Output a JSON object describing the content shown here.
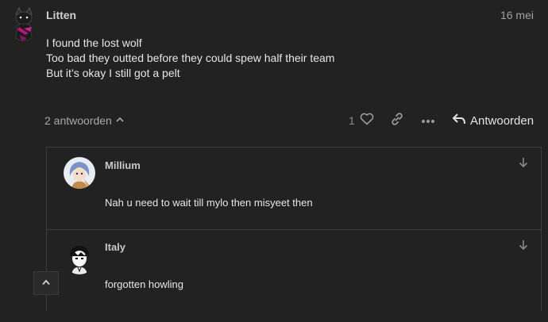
{
  "post": {
    "username": "Litten",
    "date": "16 mei",
    "lines": [
      "I found the lost wolf",
      "Too bad they outted before they could spew half their team",
      "But it’s okay I still got a pelt"
    ],
    "avatar_icon": "litten-avatar"
  },
  "actions": {
    "replies_label": "2 antwoorden",
    "like_count": "1",
    "reply_label": "Antwoorden",
    "icons": [
      "chevron-up-icon",
      "heart-icon",
      "link-icon",
      "more-icon",
      "reply-arrow-icon"
    ]
  },
  "replies": [
    {
      "username": "Millium",
      "text": "Nah u need to wait till mylo then misyeet then",
      "avatar_icon": "millium-avatar"
    },
    {
      "username": "Italy",
      "text": "forgotten howling",
      "avatar_icon": "italy-avatar"
    }
  ],
  "colors": {
    "background": "#222222",
    "border": "#3c3c3c",
    "text": "#e6e6e6",
    "muted": "#a0a0a0"
  }
}
